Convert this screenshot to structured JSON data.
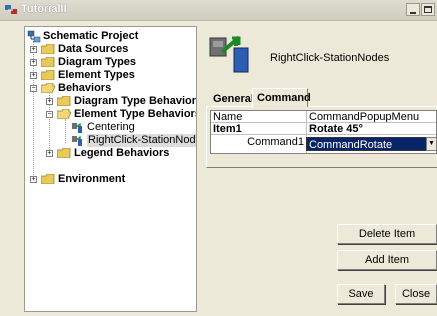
{
  "window": {
    "title": "TutorialII",
    "app_icon": "schematic-app-icon"
  },
  "tree": {
    "root": {
      "label": "Schematic Project",
      "icon": "schematic-project-icon"
    },
    "items": [
      {
        "label": "Data Sources",
        "bold": true,
        "expander": "+",
        "icon": "folder-icon"
      },
      {
        "label": "Diagram Types",
        "bold": true,
        "expander": "+",
        "icon": "folder-icon"
      },
      {
        "label": "Element Types",
        "bold": true,
        "expander": "+",
        "icon": "folder-icon"
      },
      {
        "label": "Behaviors",
        "bold": true,
        "expander": "-",
        "icon": "folder-open-icon"
      },
      {
        "label": "Diagram Type Behaviors",
        "bold": true,
        "expander": "+",
        "icon": "folder-icon"
      },
      {
        "label": "Element Type Behaviors",
        "bold": true,
        "expander": "-",
        "icon": "folder-open-icon"
      },
      {
        "label": "Centering",
        "bold": false,
        "icon": "behavior-node-icon"
      },
      {
        "label": "RightClick-StationNodes",
        "bold": false,
        "icon": "behavior-node-icon",
        "selected": true
      },
      {
        "label": "Legend Behaviors",
        "bold": true,
        "expander": "+",
        "icon": "folder-icon"
      },
      {
        "label": "Environment",
        "bold": true,
        "expander": "+",
        "icon": "folder-icon"
      }
    ]
  },
  "detail": {
    "title": "RightClick-StationNodes",
    "icon": "behavior-large-icon",
    "tabs": [
      {
        "label": "General",
        "active": false
      },
      {
        "label": "Command",
        "active": true
      }
    ],
    "grid": {
      "rows": [
        {
          "name": "Name",
          "value": "CommandPopupMenu",
          "bold": false
        },
        {
          "name": "Item1",
          "value": "Rotate 45°",
          "bold": true
        },
        {
          "name": "Command1",
          "value": "CommandRotate",
          "bold": false,
          "is_combo": true
        }
      ]
    },
    "buttons": {
      "delete_item": "Delete Item",
      "add_item": "Add Item",
      "save": "Save",
      "close": "Close"
    }
  }
}
